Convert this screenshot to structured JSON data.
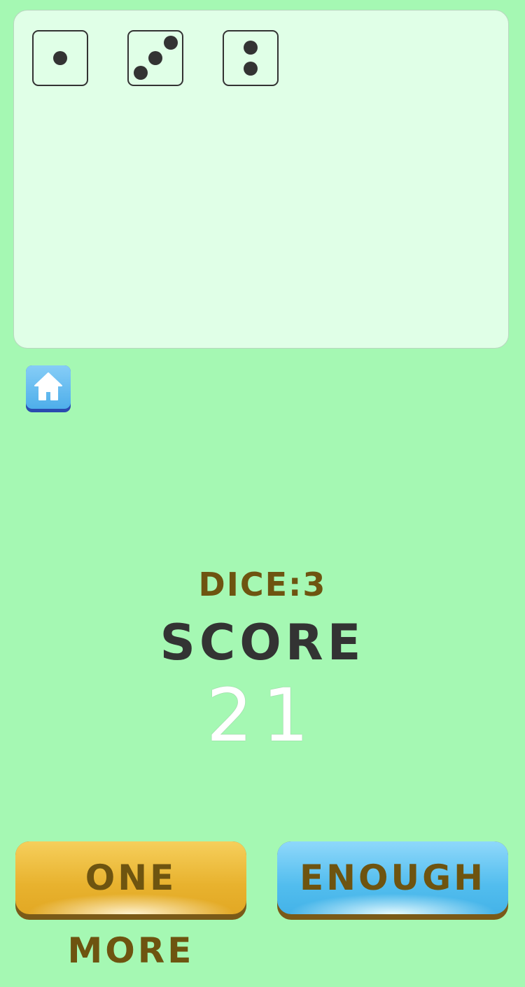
{
  "board": {
    "dice": [
      {
        "value": 1
      },
      {
        "value": 3
      },
      {
        "value": 2
      }
    ]
  },
  "home_button": {
    "icon": "home-icon"
  },
  "status": {
    "dice_label": "DICE:3",
    "score_label": "SCORE",
    "score_value": "21"
  },
  "actions": {
    "one_more_label": "ONE MORE",
    "enough_label": "ENOUGH"
  },
  "colors": {
    "background": "#a5f8b3",
    "board": "#e0ffe7",
    "gold_button": "#e8b22e",
    "blue_button": "#52bdee",
    "label_brown": "#6e5410"
  }
}
